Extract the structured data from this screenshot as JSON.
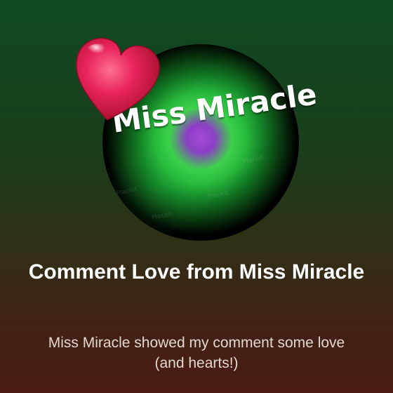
{
  "avatar": {
    "brand_text": "Miss Miracle",
    "icon": "miss-miracle-logo-avatar"
  },
  "badge": {
    "icon": "heart-icon",
    "color": "#e8245c"
  },
  "post": {
    "title": "Comment Love from Miss Miracle",
    "subtitle": "Miss Miracle showed my comment some love (and hearts!)"
  },
  "theme": {
    "background_top": "#0f4a22",
    "background_bottom": "#4a1a13",
    "avatar_glow_green": "#3fd24c",
    "avatar_glow_purple": "#a54bd8"
  }
}
